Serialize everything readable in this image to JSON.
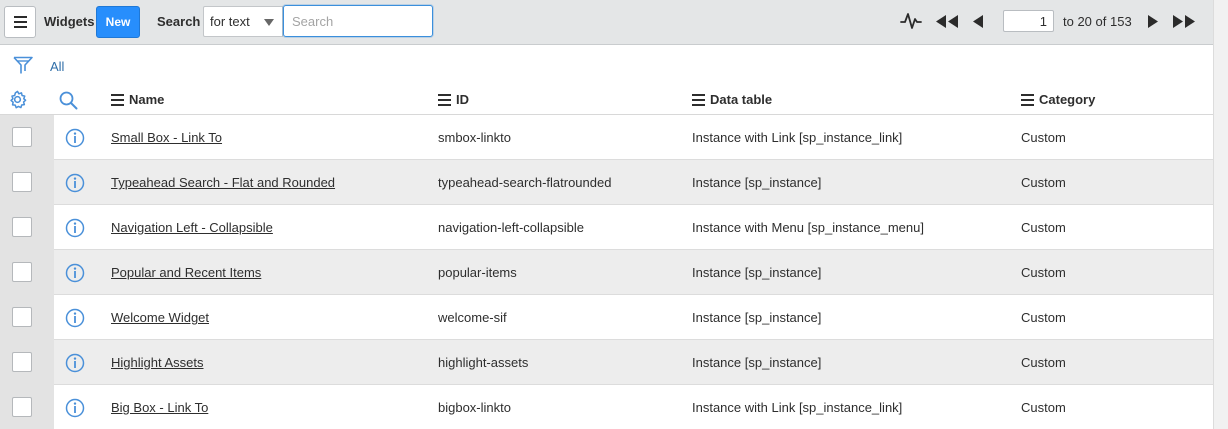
{
  "header": {
    "list_title": "Widgets",
    "new_label": "New",
    "search_label": "Search",
    "search_scope": "for text",
    "search_placeholder": "Search",
    "page_number": "1",
    "page_total": "to 20 of 153"
  },
  "filter": {
    "breadcrumb": "All"
  },
  "columns": [
    "Name",
    "ID",
    "Data table",
    "Category"
  ],
  "rows": [
    {
      "name": "Small Box - Link To",
      "id": "smbox-linkto",
      "table": "Instance with Link [sp_instance_link]",
      "category": "Custom"
    },
    {
      "name": "Typeahead Search - Flat and Rounded",
      "id": "typeahead-search-flatrounded",
      "table": "Instance [sp_instance]",
      "category": "Custom"
    },
    {
      "name": "Navigation Left - Collapsible",
      "id": "navigation-left-collapsible",
      "table": "Instance with Menu [sp_instance_menu]",
      "category": "Custom"
    },
    {
      "name": "Popular and Recent Items",
      "id": "popular-items",
      "table": "Instance [sp_instance]",
      "category": "Custom"
    },
    {
      "name": "Welcome Widget",
      "id": "welcome-sif",
      "table": "Instance [sp_instance]",
      "category": "Custom"
    },
    {
      "name": "Highlight Assets",
      "id": "highlight-assets",
      "table": "Instance [sp_instance]",
      "category": "Custom"
    },
    {
      "name": "Big Box - Link To",
      "id": "bigbox-linkto",
      "table": "Instance with Link [sp_instance_link]",
      "category": "Custom"
    }
  ],
  "icons": {
    "menu": "hamburger-icon",
    "activity": "activity-stream-icon",
    "first": "first-page-icon",
    "prev": "previous-page-icon",
    "next": "next-page-icon",
    "last": "last-page-icon",
    "filter": "filter-icon",
    "gear": "gear-icon",
    "search": "search-icon",
    "info": "info-icon"
  },
  "colors": {
    "accent": "#278efc",
    "link": "#2f6ea8",
    "icon_blue": "#4a90d9",
    "header_bg": "#e4e6e7"
  }
}
